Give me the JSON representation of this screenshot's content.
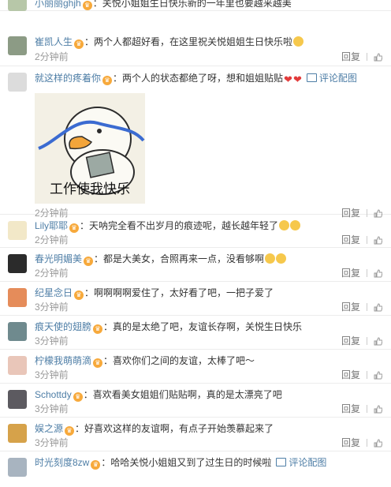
{
  "actions": {
    "reply_label": "回复",
    "like_icon": "thumb-up-icon",
    "pic_link_label": "评论配图"
  },
  "colors": {
    "username": "#4e7ea6",
    "badge": "#f7a93b",
    "meta": "#999999"
  },
  "comments": [
    {
      "username": "小丽丽ghjh",
      "text": "关悦小姐姐生日快乐新的一年里也要越来越美",
      "time": "",
      "avatar": "#b7c7a8",
      "emoji": []
    },
    {
      "username": "崔凯人生",
      "text": "两个人都超好看，在这里祝关悦姐姐生日快乐啦",
      "time": "2分钟前",
      "avatar": "#8c9b85",
      "emoji": [
        "face"
      ]
    },
    {
      "username": "就这样的疼着你",
      "text": "两个人的状态都绝了呀，想和姐姐贴贴",
      "time": "2分钟前",
      "avatar": "#dcdcdc",
      "emoji": [
        "heart",
        "heart"
      ],
      "has_pic_link": true,
      "image_caption": "工作使我快乐"
    },
    {
      "username": "Lily耶耶",
      "text": "天呐完全看不出岁月的痕迹呢，越长越年轻了",
      "time": "2分钟前",
      "avatar": "#f2e8c8",
      "emoji": [
        "face",
        "face"
      ]
    },
    {
      "username": "春光明媚美",
      "text": "都是大美女，合照再来一点，没看够啊",
      "time": "2分钟前",
      "avatar": "#2b2b2b",
      "emoji": [
        "face",
        "face"
      ]
    },
    {
      "username": "纪星念日",
      "text": "啊啊啊啊爱住了，太好看了吧，一把子爱了",
      "time": "3分钟前",
      "avatar": "#e58c5a",
      "emoji": []
    },
    {
      "username": "痕天使的翅膀",
      "text": "真的是太绝了吧，友谊长存啊，关悦生日快乐",
      "time": "3分钟前",
      "avatar": "#6f8a8e",
      "emoji": []
    },
    {
      "username": "柠檬我萌萌滴",
      "text": "喜欢你们之间的友谊，太棒了吧～",
      "time": "3分钟前",
      "avatar": "#e9c6b9",
      "emoji": []
    },
    {
      "username": "Schottdy",
      "text": "喜欢看美女姐姐们贴贴啊，真的是太漂亮了吧",
      "time": "3分钟前",
      "avatar": "#5c5a60",
      "emoji": []
    },
    {
      "username": "娱之源",
      "text": "好喜欢这样的友谊啊，有点子开始羡慕起来了",
      "time": "3分钟前",
      "avatar": "#d6a24a",
      "emoji": []
    },
    {
      "username": "时光刻度8zw",
      "text": "哈哈关悦小姐姐又到了过生日的时候啦",
      "time": "",
      "avatar": "#a8b4c0",
      "emoji": [],
      "has_pic_link": true
    }
  ]
}
